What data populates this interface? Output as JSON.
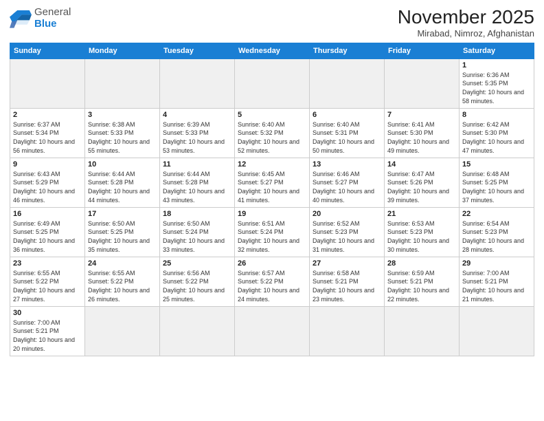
{
  "logo": {
    "general": "General",
    "blue": "Blue"
  },
  "title": "November 2025",
  "location": "Mirabad, Nimroz, Afghanistan",
  "days_of_week": [
    "Sunday",
    "Monday",
    "Tuesday",
    "Wednesday",
    "Thursday",
    "Friday",
    "Saturday"
  ],
  "weeks": [
    [
      {
        "num": "",
        "info": ""
      },
      {
        "num": "",
        "info": ""
      },
      {
        "num": "",
        "info": ""
      },
      {
        "num": "",
        "info": ""
      },
      {
        "num": "",
        "info": ""
      },
      {
        "num": "",
        "info": ""
      },
      {
        "num": "1",
        "info": "Sunrise: 6:36 AM\nSunset: 5:35 PM\nDaylight: 10 hours\nand 58 minutes."
      }
    ],
    [
      {
        "num": "2",
        "info": "Sunrise: 6:37 AM\nSunset: 5:34 PM\nDaylight: 10 hours\nand 56 minutes."
      },
      {
        "num": "3",
        "info": "Sunrise: 6:38 AM\nSunset: 5:33 PM\nDaylight: 10 hours\nand 55 minutes."
      },
      {
        "num": "4",
        "info": "Sunrise: 6:39 AM\nSunset: 5:33 PM\nDaylight: 10 hours\nand 53 minutes."
      },
      {
        "num": "5",
        "info": "Sunrise: 6:40 AM\nSunset: 5:32 PM\nDaylight: 10 hours\nand 52 minutes."
      },
      {
        "num": "6",
        "info": "Sunrise: 6:40 AM\nSunset: 5:31 PM\nDaylight: 10 hours\nand 50 minutes."
      },
      {
        "num": "7",
        "info": "Sunrise: 6:41 AM\nSunset: 5:30 PM\nDaylight: 10 hours\nand 49 minutes."
      },
      {
        "num": "8",
        "info": "Sunrise: 6:42 AM\nSunset: 5:30 PM\nDaylight: 10 hours\nand 47 minutes."
      }
    ],
    [
      {
        "num": "9",
        "info": "Sunrise: 6:43 AM\nSunset: 5:29 PM\nDaylight: 10 hours\nand 46 minutes."
      },
      {
        "num": "10",
        "info": "Sunrise: 6:44 AM\nSunset: 5:28 PM\nDaylight: 10 hours\nand 44 minutes."
      },
      {
        "num": "11",
        "info": "Sunrise: 6:44 AM\nSunset: 5:28 PM\nDaylight: 10 hours\nand 43 minutes."
      },
      {
        "num": "12",
        "info": "Sunrise: 6:45 AM\nSunset: 5:27 PM\nDaylight: 10 hours\nand 41 minutes."
      },
      {
        "num": "13",
        "info": "Sunrise: 6:46 AM\nSunset: 5:27 PM\nDaylight: 10 hours\nand 40 minutes."
      },
      {
        "num": "14",
        "info": "Sunrise: 6:47 AM\nSunset: 5:26 PM\nDaylight: 10 hours\nand 39 minutes."
      },
      {
        "num": "15",
        "info": "Sunrise: 6:48 AM\nSunset: 5:25 PM\nDaylight: 10 hours\nand 37 minutes."
      }
    ],
    [
      {
        "num": "16",
        "info": "Sunrise: 6:49 AM\nSunset: 5:25 PM\nDaylight: 10 hours\nand 36 minutes."
      },
      {
        "num": "17",
        "info": "Sunrise: 6:50 AM\nSunset: 5:25 PM\nDaylight: 10 hours\nand 35 minutes."
      },
      {
        "num": "18",
        "info": "Sunrise: 6:50 AM\nSunset: 5:24 PM\nDaylight: 10 hours\nand 33 minutes."
      },
      {
        "num": "19",
        "info": "Sunrise: 6:51 AM\nSunset: 5:24 PM\nDaylight: 10 hours\nand 32 minutes."
      },
      {
        "num": "20",
        "info": "Sunrise: 6:52 AM\nSunset: 5:23 PM\nDaylight: 10 hours\nand 31 minutes."
      },
      {
        "num": "21",
        "info": "Sunrise: 6:53 AM\nSunset: 5:23 PM\nDaylight: 10 hours\nand 30 minutes."
      },
      {
        "num": "22",
        "info": "Sunrise: 6:54 AM\nSunset: 5:23 PM\nDaylight: 10 hours\nand 28 minutes."
      }
    ],
    [
      {
        "num": "23",
        "info": "Sunrise: 6:55 AM\nSunset: 5:22 PM\nDaylight: 10 hours\nand 27 minutes."
      },
      {
        "num": "24",
        "info": "Sunrise: 6:55 AM\nSunset: 5:22 PM\nDaylight: 10 hours\nand 26 minutes."
      },
      {
        "num": "25",
        "info": "Sunrise: 6:56 AM\nSunset: 5:22 PM\nDaylight: 10 hours\nand 25 minutes."
      },
      {
        "num": "26",
        "info": "Sunrise: 6:57 AM\nSunset: 5:22 PM\nDaylight: 10 hours\nand 24 minutes."
      },
      {
        "num": "27",
        "info": "Sunrise: 6:58 AM\nSunset: 5:21 PM\nDaylight: 10 hours\nand 23 minutes."
      },
      {
        "num": "28",
        "info": "Sunrise: 6:59 AM\nSunset: 5:21 PM\nDaylight: 10 hours\nand 22 minutes."
      },
      {
        "num": "29",
        "info": "Sunrise: 7:00 AM\nSunset: 5:21 PM\nDaylight: 10 hours\nand 21 minutes."
      }
    ],
    [
      {
        "num": "30",
        "info": "Sunrise: 7:00 AM\nSunset: 5:21 PM\nDaylight: 10 hours\nand 20 minutes."
      },
      {
        "num": "",
        "info": ""
      },
      {
        "num": "",
        "info": ""
      },
      {
        "num": "",
        "info": ""
      },
      {
        "num": "",
        "info": ""
      },
      {
        "num": "",
        "info": ""
      },
      {
        "num": "",
        "info": ""
      }
    ]
  ]
}
